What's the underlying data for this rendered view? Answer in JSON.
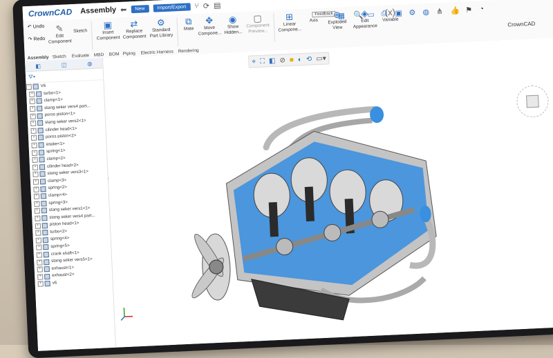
{
  "app": {
    "brand": "CrownCAD",
    "doc_title": "Assembly",
    "new_label": "New",
    "import_export_label": "Import/Export",
    "feedback_label": "Feedback",
    "brand_right": "CrownCAD"
  },
  "ribbon": {
    "undo": "Undo",
    "redo": "Redo",
    "edit_component": "Edit Component",
    "sketch": "Sketch",
    "insert_component": "Insert Component",
    "replace_component": "Replace Component",
    "standard_part_library": "Standard Part Library",
    "mate": "Mate",
    "move_component": "Move Compone...",
    "show_hidden": "Show Hidden...",
    "component_preview": "Component Preview...",
    "linear_component": "Linear Compone...",
    "axis": "Axis",
    "exploded_view": "Exploded View",
    "edit_appearance": "Edit Appearance",
    "variable": "Variable"
  },
  "tabs": [
    "Assembly",
    "Sketch",
    "Evaluate",
    "MBD",
    "BOM",
    "Piping",
    "Electric Harness",
    "Rendering"
  ],
  "tree": {
    "root": "V6",
    "items": [
      "turbo<1>",
      "clamp<1>",
      "stang seker vers4 part...",
      "poros piston<1>",
      "stang seker vers2<1>",
      "cilinder head<1>",
      "poros piston<2>",
      "intake<1>",
      "spring<1>",
      "clamp<2>",
      "cilinder head<2>",
      "stang seker vers3<1>",
      "clamp<3>",
      "spring<2>",
      "clamp<4>",
      "spring<3>",
      "stang seker vers1<1>",
      "stang seker vers4 part...",
      "piston head<1>",
      "turbo<2>",
      "spring<4>",
      "spring<5>",
      "crank shaft<1>",
      "stang seker vers5<1>",
      "exhaust<1>",
      "exhaust<2>",
      "v6"
    ]
  },
  "colors": {
    "accent": "#2d6fc4",
    "section_blue": "#3a8fe0",
    "part_gray": "#b8b8b8"
  }
}
